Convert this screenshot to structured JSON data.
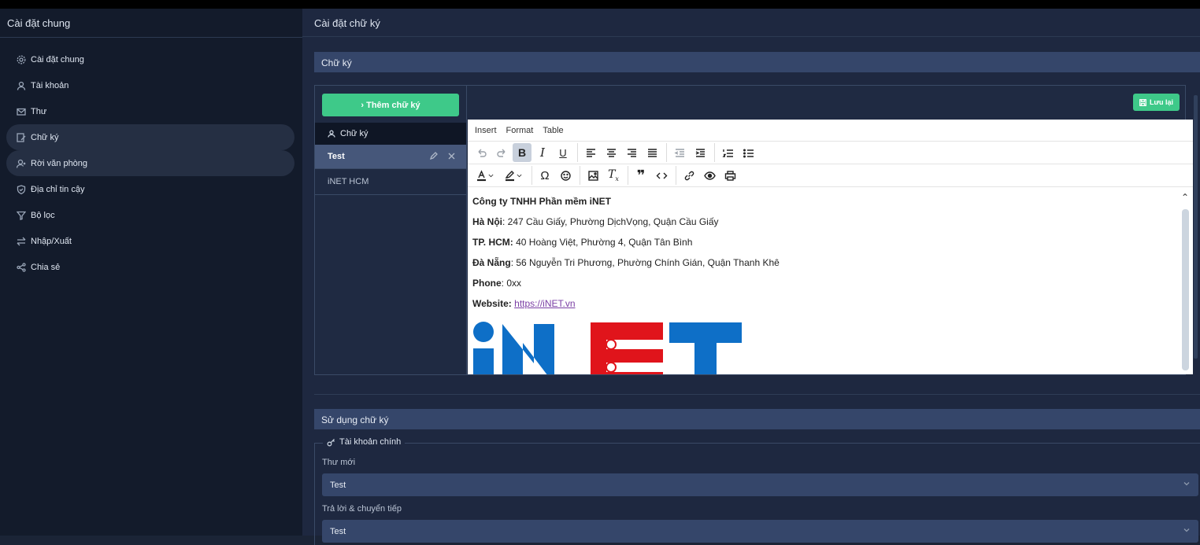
{
  "sidebar": {
    "title": "Cài đặt chung",
    "items": [
      {
        "label": "Cài đặt chung",
        "icon": "gear-icon"
      },
      {
        "label": "Tài khoản",
        "icon": "user-icon"
      },
      {
        "label": "Thư",
        "icon": "mail-icon"
      },
      {
        "label": "Chữ ký",
        "icon": "signature-icon"
      },
      {
        "label": "Rời văn phòng",
        "icon": "user-away-icon"
      },
      {
        "label": "Địa chỉ tin cậy",
        "icon": "shield-icon"
      },
      {
        "label": "Bộ lọc",
        "icon": "filter-icon"
      },
      {
        "label": "Nhập/Xuất",
        "icon": "import-export-icon"
      },
      {
        "label": "Chia sẻ",
        "icon": "share-icon"
      }
    ]
  },
  "main": {
    "title": "Cài đặt chữ ký",
    "signature_section": "Chữ ký",
    "add_button": "› Thêm chữ ký",
    "list_header": "Chữ ký",
    "signatures": [
      "Test",
      "iNET HCM"
    ],
    "save_button": "Lưu lại",
    "menubar": [
      "Insert",
      "Format",
      "Table"
    ],
    "usage_section": "Sử dụng chữ ký",
    "main_account": "Tài khoản chính",
    "new_mail_label": "Thư mới",
    "new_mail_value": "Test",
    "reply_label": "Trả lời & chuyển tiếp",
    "reply_value": "Test"
  },
  "content": {
    "company": "Công ty TNHH Phần mềm iNET",
    "hanoi_label": "Hà Nội",
    "hanoi_text": ": 247 Cầu Giấy, Phường DịchVọng, Quận Cầu Giấy",
    "hcm_label": "TP. HCM:",
    "hcm_text": " 40 Hoàng Việt, Phường 4, Quận Tân Bình",
    "danang_label": "Đà Nẵng",
    "danang_text": ": 56 Nguyễn Tri Phương, Phường Chính Gián, Quận Thanh Khê",
    "phone_label": "Phone",
    "phone_text": ": 0xx",
    "website_label": "Website:",
    "website_link": "https://iNET.vn",
    "logo_text": "iNET"
  },
  "colors": {
    "accent_green": "#3ec989",
    "logo_blue": "#0e6fc7",
    "logo_red": "#e0141b"
  }
}
